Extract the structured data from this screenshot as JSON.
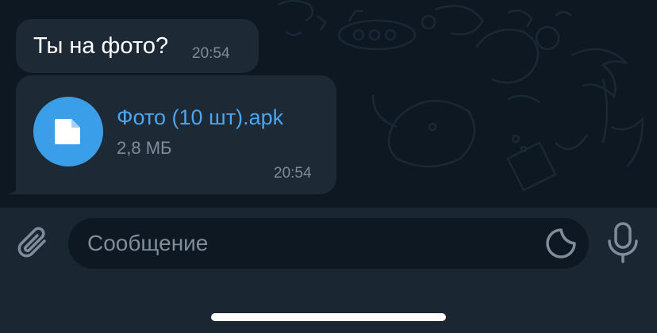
{
  "messages": [
    {
      "text": "Ты на фото?",
      "time": "20:54"
    },
    {
      "file": {
        "name": "Фото (10 шт).apk",
        "size": "2,8 МБ",
        "icon": "document-icon"
      },
      "time": "20:54"
    }
  ],
  "composer": {
    "placeholder": "Сообщение",
    "attach_icon": "paperclip-icon",
    "sticker_icon": "sticker-icon",
    "mic_icon": "microphone-icon"
  },
  "colors": {
    "chat_background": "#0e1822",
    "bubble": "#1d2935",
    "accent": "#3a9fe8",
    "link": "#4aa6f0",
    "muted": "#7f8c99"
  }
}
